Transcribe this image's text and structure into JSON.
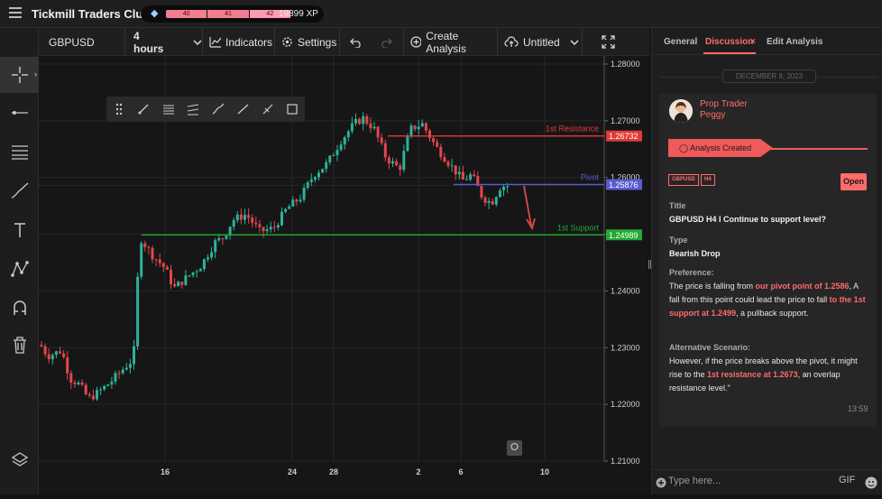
{
  "header": {
    "brand": "Tickmill Traders Club",
    "xp_segments": [
      "40",
      "41",
      "42"
    ],
    "xp_value": "19899 XP"
  },
  "toolbar": {
    "symbol": "GBPUSD",
    "timeframe": "4 hours",
    "indicators": "Indicators",
    "settings": "Settings",
    "create_analysis": "Create Analysis",
    "layout_name": "Untitled"
  },
  "left_tools": [
    "crosshair-icon",
    "horizontal-line-icon",
    "fib-lines-icon",
    "brush-icon",
    "text-icon",
    "pattern-icon",
    "magnet-icon",
    "trash-icon",
    "layers-icon"
  ],
  "chart": {
    "price_axis": [
      "1.28000",
      "1.27000",
      "1.26000",
      "1.25000",
      "1.24000",
      "1.23000",
      "1.22000",
      "1.21000"
    ],
    "time_axis": [
      "16",
      "24",
      "28",
      "2",
      "6",
      "10"
    ],
    "resistance": {
      "label": "1st Resistance",
      "price": "1.26732",
      "color": "#e03a3a"
    },
    "pivot": {
      "label": "Pivot",
      "price": "1.25876",
      "color": "#5b5bd6"
    },
    "support": {
      "label": "1st Support",
      "price": "1.24989",
      "color": "#22aa33"
    },
    "up_color": "#2bb39a",
    "down_color": "#e2474b"
  },
  "panel": {
    "tabs": [
      "General",
      "Discussion",
      "Edit Analysis"
    ],
    "active_tab": "Discussion",
    "date": "DECEMBER 8, 2023",
    "author_role": "Prop Trader",
    "author_name": "Peggy",
    "banner": "Analysis Created",
    "tags": [
      "GBPUSD",
      "H4"
    ],
    "open_button": "Open",
    "title_label": "Title",
    "title_value": "GBPUSD H4 I Continue to support level?",
    "type_label": "Type",
    "type_value": "Bearish Drop",
    "pref_label": "Preference:",
    "pref_t1": "The price is falling from ",
    "pref_h1": "our pivot point of 1.2586",
    "pref_t2": ", A fall from this point could lead the price to fall ",
    "pref_h2": "to the 1st support at 1.2499",
    "pref_t3": ", a pullback support.",
    "alt_label": "Alternative Scenario:",
    "alt_t1": "However, if the price breaks above the pivot, it might rise to the ",
    "alt_h1": "1st resistance at 1.2673",
    "alt_t2": ", an overlap resistance level.\"",
    "time": "13:59",
    "input_placeholder": "Type here...",
    "gif_label": "GIF"
  }
}
